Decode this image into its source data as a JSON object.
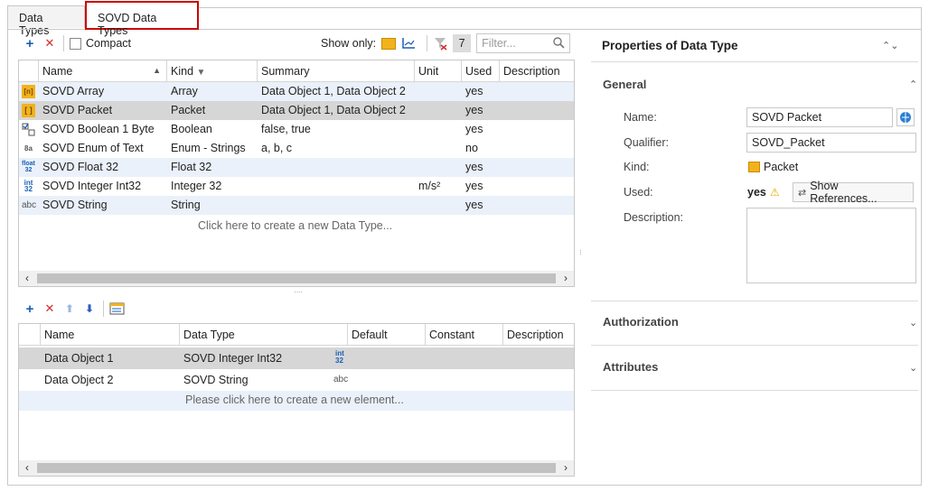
{
  "tabs": [
    {
      "label": "Data Types"
    },
    {
      "label": "SOVD Data Types"
    }
  ],
  "types_toolbar": {
    "compact_label": "Compact",
    "show_only_label": "Show only:",
    "filter_count": "7",
    "filter_placeholder": "Filter..."
  },
  "types_grid": {
    "columns": [
      "Name",
      "Kind",
      "Summary",
      "Unit",
      "Used",
      "Description"
    ],
    "rows": [
      {
        "icon": "array-icon",
        "name": "SOVD Array",
        "kind": "Array",
        "summary": "Data Object 1, Data Object 2",
        "unit": "",
        "used": "yes"
      },
      {
        "icon": "packet-icon",
        "name": "SOVD Packet",
        "kind": "Packet",
        "summary": "Data Object 1, Data Object 2",
        "unit": "",
        "used": "yes"
      },
      {
        "icon": "boolean-icon",
        "name": "SOVD Boolean 1 Byte",
        "kind": "Boolean",
        "summary": "false, true",
        "unit": "",
        "used": "yes"
      },
      {
        "icon": "enum-icon",
        "name": "SOVD Enum of Text",
        "kind": "Enum - Strings",
        "summary": "a, b, c",
        "unit": "",
        "used": "no"
      },
      {
        "icon": "float-icon",
        "name": "SOVD Float 32",
        "kind": "Float 32",
        "summary": "",
        "unit": "",
        "used": "yes"
      },
      {
        "icon": "integer-icon",
        "name": "SOVD Integer Int32",
        "kind": "Integer 32",
        "summary": "",
        "unit": "m/s²",
        "used": "yes"
      },
      {
        "icon": "string-icon",
        "name": "SOVD String",
        "kind": "String",
        "summary": "",
        "unit": "",
        "used": "yes"
      }
    ],
    "create_hint": "Click here to create a new Data Type..."
  },
  "elements_grid": {
    "columns": [
      "Name",
      "Data Type",
      "Default",
      "Constant",
      "Description"
    ],
    "rows": [
      {
        "name": "Data Object 1",
        "data_type": "SOVD Integer Int32",
        "type_icon_text": "int 32"
      },
      {
        "name": "Data Object 2",
        "data_type": "SOVD String",
        "type_icon_text": "abc"
      }
    ],
    "create_hint": "Please click here to create a new element..."
  },
  "properties": {
    "title": "Properties of Data Type",
    "general": {
      "title": "General",
      "name_label": "Name:",
      "name_value": "SOVD Packet",
      "qualifier_label": "Qualifier:",
      "qualifier_value": "SOVD_Packet",
      "kind_label": "Kind:",
      "kind_value": "Packet",
      "used_label": "Used:",
      "used_value": "yes",
      "show_references_label": "Show References...",
      "description_label": "Description:"
    },
    "authorization_title": "Authorization",
    "attributes_title": "Attributes"
  },
  "colors": {
    "selection_border": "#cc0000",
    "alt_row": "#eaf1fa",
    "selected_row": "#d6d6d6",
    "accent_blue": "#1a5fb4"
  }
}
